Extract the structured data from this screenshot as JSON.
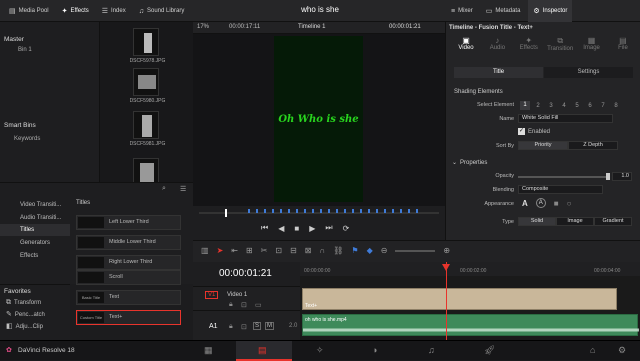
{
  "topbar": {
    "media_pool": "Media Pool",
    "effects": "Effects",
    "index": "Index",
    "sound_library": "Sound Library",
    "project_name": "who is she",
    "mixer": "Mixer",
    "metadata": "Metadata",
    "inspector": "Inspector"
  },
  "media": {
    "master": "Master",
    "bin1": "Bin 1",
    "smart_bins": "Smart Bins",
    "keywords": "Keywords",
    "thumbs": [
      "DSCF5978.JPG",
      "DSCF5980.JPG",
      "DSCF5981.JPG",
      ""
    ]
  },
  "viewer": {
    "zoom": "17%",
    "timecode": "00:00:17:11",
    "timeline_name": "Timeline 1",
    "current_tc": "00:00:01:21",
    "title_text": "Oh Who is she"
  },
  "inspector": {
    "header": "Timeline - Fusion Title - Text+",
    "tabs": [
      "Video",
      "Audio",
      "Effects",
      "Transition",
      "Image",
      "File"
    ],
    "subtabs": [
      "Title",
      "Settings"
    ],
    "section_shading": "Shading Elements",
    "select_element_label": "Select Element",
    "element_numbers": [
      "1",
      "2",
      "3",
      "4",
      "5",
      "6",
      "7",
      "8"
    ],
    "name_label": "Name",
    "name_value": "White Solid Fill",
    "enabled_label": "Enabled",
    "sortby_label": "Sort By",
    "sort_priority": "Priority",
    "sort_depth": "Z Depth",
    "section_properties": "Properties",
    "opacity_label": "Opacity",
    "opacity_value": "1.0",
    "blending_label": "Blending",
    "blending_value": "Composite",
    "appearance_label": "Appearance",
    "type_label": "Type",
    "type_options": [
      "Solid",
      "Image",
      "Gradient"
    ]
  },
  "effects": {
    "items": [
      "Video Transiti...",
      "Audio Transiti...",
      "Titles",
      "Generators",
      "Effects"
    ],
    "selected_index": 2,
    "titles_heading": "Titles",
    "title_list": [
      {
        "thumb": "",
        "name": "Left Lower Third"
      },
      {
        "thumb": "",
        "name": "Middle Lower Third"
      },
      {
        "thumb": "",
        "name": "Right Lower Third"
      },
      {
        "thumb": "",
        "name": "Scroll"
      },
      {
        "thumb": "Basic Title",
        "name": "Text"
      },
      {
        "thumb": "Custom Title",
        "name": "Text+"
      }
    ]
  },
  "favorites": {
    "heading": "Favorites",
    "items": [
      "Transform",
      "Penc...atch",
      "Adju...Clip"
    ]
  },
  "timeline": {
    "timecode": "00:00:01:21",
    "ruler": [
      "00:00:00:00",
      "00:00:02:00",
      "00:00:04:00"
    ],
    "v1": "V1",
    "video1": "Video 1",
    "a1": "A1",
    "a1_level": "2.0",
    "text_clip": "Text+",
    "audio_clip": "oh who is she.mp4"
  },
  "bottombar": {
    "app": "DaVinci Resolve 18"
  },
  "colors": {
    "accent": "#e8342c",
    "title_green": "#28d41e",
    "text_clip": "#c9b79a",
    "audio_clip": "#3e8a5a",
    "playhead": "#e8342c",
    "active_blue": "#3f7bd8"
  }
}
